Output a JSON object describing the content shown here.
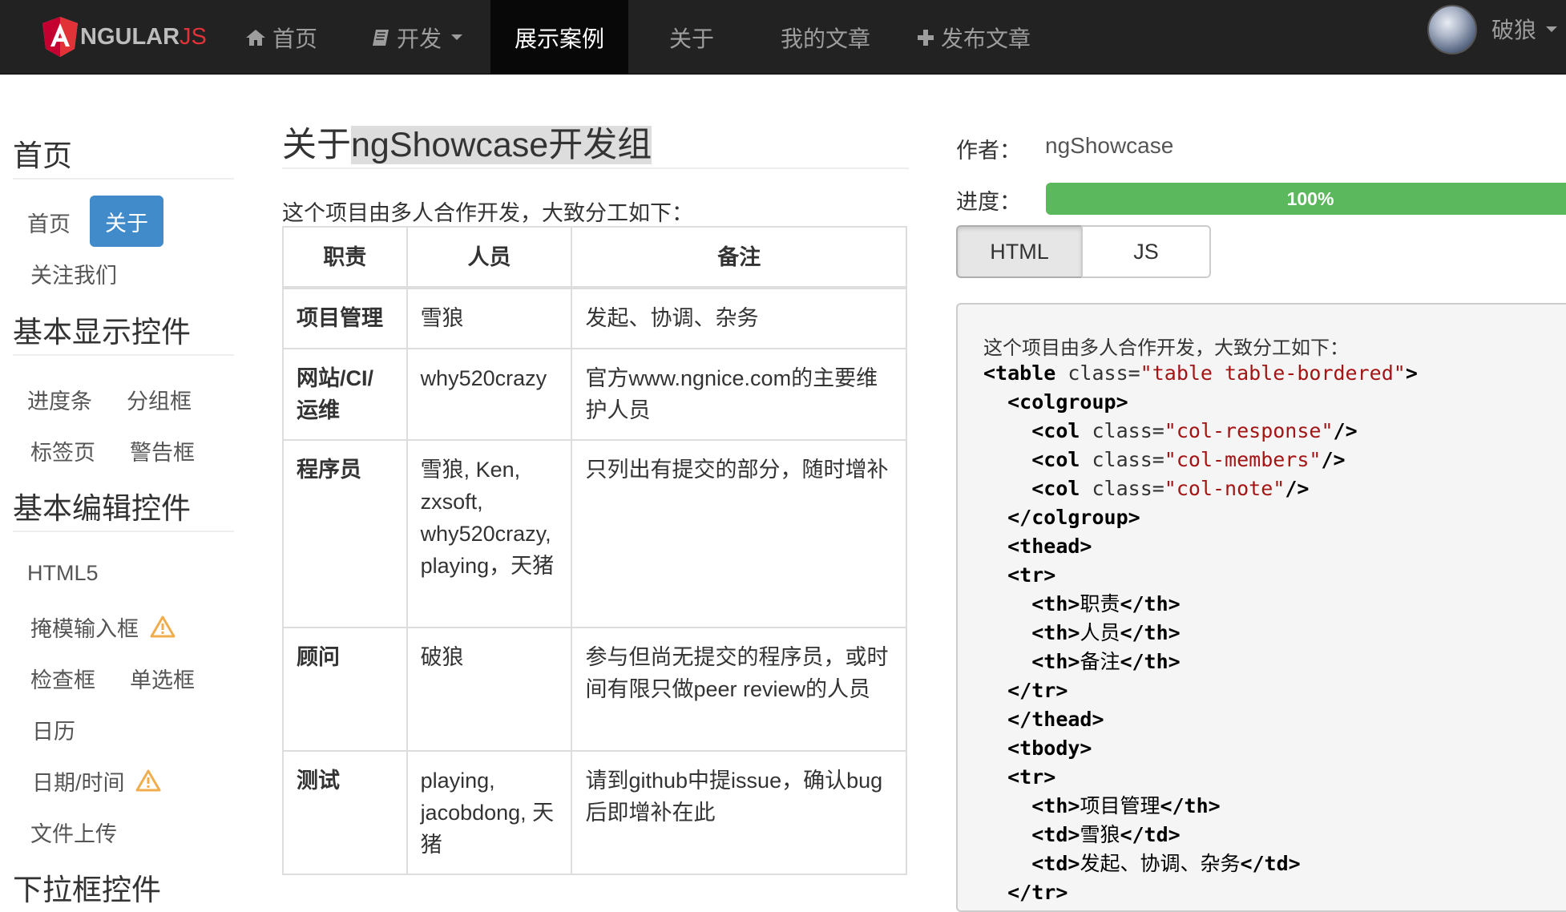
{
  "navbar": {
    "brand_main": "NGULAR",
    "brand_js": "JS",
    "items": [
      {
        "label": "首页",
        "icon": "home-icon"
      },
      {
        "label": "开发",
        "icon": "book-icon"
      },
      {
        "label": "展示案例",
        "active": true
      },
      {
        "label": "关于"
      },
      {
        "label": "我的文章"
      },
      {
        "label": "发布文章",
        "icon": "plus-icon"
      }
    ],
    "user": "破狼"
  },
  "sidebar": {
    "sections": [
      {
        "title": "首页",
        "links": [
          "首页",
          "关于",
          "关注我们"
        ],
        "active": "关于"
      },
      {
        "title": "基本显示控件",
        "links": [
          "进度条",
          "分组框",
          "标签页",
          "警告框"
        ]
      },
      {
        "title": "基本编辑控件",
        "links": [
          "HTML5",
          "掩模输入框",
          "检查框",
          "单选框",
          "日历",
          "日期/时间",
          "文件上传"
        ]
      },
      {
        "title": "下拉框控件"
      }
    ]
  },
  "main": {
    "title_prefix": "关于",
    "title_highlight": "ngShowcase开发组",
    "intro": "这个项目由多人合作开发，大致分工如下：",
    "table": {
      "headers": [
        "职责",
        "人员",
        "备注"
      ],
      "rows": [
        {
          "role": "项目管理",
          "members": "雪狼",
          "note": "发起、协调、杂务"
        },
        {
          "role": "网站/CI/运维",
          "members": "why520crazy",
          "note": "官方www.ngnice.com的主要维护人员"
        },
        {
          "role": "程序员",
          "members": "雪狼, Ken, zxsoft, why520crazy, playing，天猪",
          "note": "只列出有提交的部分，随时增补"
        },
        {
          "role": "顾问",
          "members": "破狼",
          "note": "参与但尚无提交的程序员，或时间有限只做peer review的人员"
        },
        {
          "role": "测试",
          "members": "playing, jacobdong, 天猪",
          "note": "请到github中提issue，确认bug后即增补在此"
        }
      ]
    }
  },
  "right": {
    "author_label": "作者：",
    "author_value": "ngShowcase",
    "progress_label": "进度：",
    "progress_text": "100%",
    "progress_value": 1.0,
    "tabs": [
      "HTML",
      "JS"
    ],
    "active_tab": "HTML",
    "code_intro": "这个项目由多人合作开发，大致分工如下：",
    "code_lines": [
      {
        "indent": 0,
        "parts": [
          [
            "tag",
            "<table"
          ],
          [
            "attr",
            " class="
          ],
          [
            "str",
            "\"table table-bordered\""
          ],
          [
            "tag",
            ">"
          ]
        ]
      },
      {
        "indent": 1,
        "parts": [
          [
            "tag",
            "<colgroup>"
          ]
        ]
      },
      {
        "indent": 2,
        "parts": [
          [
            "tag",
            "<col"
          ],
          [
            "attr",
            " class="
          ],
          [
            "str",
            "\"col-response\""
          ],
          [
            "tag",
            "/>"
          ]
        ]
      },
      {
        "indent": 2,
        "parts": [
          [
            "tag",
            "<col"
          ],
          [
            "attr",
            " class="
          ],
          [
            "str",
            "\"col-members\""
          ],
          [
            "tag",
            "/>"
          ]
        ]
      },
      {
        "indent": 2,
        "parts": [
          [
            "tag",
            "<col"
          ],
          [
            "attr",
            " class="
          ],
          [
            "str",
            "\"col-note\""
          ],
          [
            "tag",
            "/>"
          ]
        ]
      },
      {
        "indent": 1,
        "parts": [
          [
            "tag",
            "</colgroup>"
          ]
        ]
      },
      {
        "indent": 1,
        "parts": [
          [
            "tag",
            "<thead>"
          ]
        ]
      },
      {
        "indent": 1,
        "parts": [
          [
            "tag",
            "<tr>"
          ]
        ]
      },
      {
        "indent": 2,
        "parts": [
          [
            "tag",
            "<th>"
          ],
          [
            "txt",
            "职责"
          ],
          [
            "tag",
            "</th>"
          ]
        ]
      },
      {
        "indent": 2,
        "parts": [
          [
            "tag",
            "<th>"
          ],
          [
            "txt",
            "人员"
          ],
          [
            "tag",
            "</th>"
          ]
        ]
      },
      {
        "indent": 2,
        "parts": [
          [
            "tag",
            "<th>"
          ],
          [
            "txt",
            "备注"
          ],
          [
            "tag",
            "</th>"
          ]
        ]
      },
      {
        "indent": 1,
        "parts": [
          [
            "tag",
            "</tr>"
          ]
        ]
      },
      {
        "indent": 1,
        "parts": [
          [
            "tag",
            "</thead>"
          ]
        ]
      },
      {
        "indent": 1,
        "parts": [
          [
            "tag",
            "<tbody>"
          ]
        ]
      },
      {
        "indent": 1,
        "parts": [
          [
            "tag",
            "<tr>"
          ]
        ]
      },
      {
        "indent": 2,
        "parts": [
          [
            "tag",
            "<th>"
          ],
          [
            "txt",
            "项目管理"
          ],
          [
            "tag",
            "</th>"
          ]
        ]
      },
      {
        "indent": 2,
        "parts": [
          [
            "tag",
            "<td>"
          ],
          [
            "txt",
            "雪狼"
          ],
          [
            "tag",
            "</td>"
          ]
        ]
      },
      {
        "indent": 2,
        "parts": [
          [
            "tag",
            "<td>"
          ],
          [
            "txt",
            "发起、协调、杂务"
          ],
          [
            "tag",
            "</td>"
          ]
        ]
      },
      {
        "indent": 1,
        "parts": [
          [
            "tag",
            "</tr>"
          ]
        ]
      }
    ]
  },
  "colors": {
    "navbar_bg": "#222222",
    "accent": "#428bca",
    "progress": "#5cb85c",
    "warning": "#f0ad4e",
    "code_string": "#a31515"
  }
}
